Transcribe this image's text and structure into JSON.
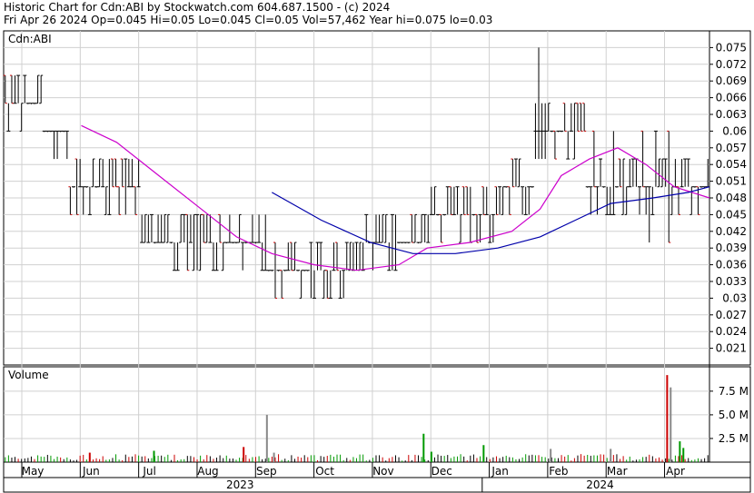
{
  "header": {
    "line1": "Historic Chart for Cdn:ABI by Stockwatch.com 604.687.1500 - (c) 2024",
    "line2": "Fri Apr 26 2024  Op=0.045  Hi=0.05  Lo=0.045  Cl=0.05  Vol=57,462  Year hi=0.075  lo=0.03"
  },
  "colors": {
    "background": "#ffffff",
    "grid": "#d0d0d0",
    "bar": "#000000",
    "bar_down": "#cc0000",
    "ma_short": "#cc00cc",
    "ma_long": "#0000aa",
    "vol_up": "#009900",
    "vol_down": "#cc0000",
    "vol_flat": "#000000"
  },
  "chart_data": [
    {
      "type": "ohlc",
      "panel": "price",
      "symbol_label": "Cdn:ABI",
      "ylim": [
        0.018,
        0.078
      ],
      "y_ticks": [
        "0.075",
        "0.072",
        "0.069",
        "0.066",
        "0.063",
        "0.06",
        "0.057",
        "0.054",
        "0.051",
        "0.048",
        "0.045",
        "0.042",
        "0.039",
        "0.036",
        "0.033",
        "0.03",
        "0.027",
        "0.024",
        "0.021"
      ],
      "x_month_labels": [
        "May",
        "Jun",
        "Jul",
        "Aug",
        "Sep",
        "Oct",
        "Nov",
        "Dec",
        "Jan",
        "Feb",
        "Mar",
        "Apr"
      ],
      "x_year_labels": [
        "2023",
        "2024"
      ],
      "grid": true,
      "segments": [
        {
          "days": 12,
          "levels": [
            0.065,
            0.07,
            0.06
          ],
          "pattern": "choppy"
        },
        {
          "days": 8,
          "levels": [
            0.06,
            0.06,
            0.055
          ],
          "pattern": "flat"
        },
        {
          "days": 22,
          "levels": [
            0.05,
            0.055,
            0.045
          ],
          "pattern": "choppy"
        },
        {
          "days": 14,
          "levels": [
            0.042,
            0.045,
            0.04
          ],
          "pattern": "choppy"
        },
        {
          "days": 25,
          "levels": [
            0.04,
            0.045,
            0.035
          ],
          "pattern": "choppy"
        },
        {
          "days": 20,
          "levels": [
            0.037,
            0.04,
            0.03
          ],
          "pattern": "choppy"
        },
        {
          "days": 10,
          "levels": [
            0.035,
            0.04,
            0.03
          ],
          "pattern": "choppy"
        },
        {
          "days": 20,
          "levels": [
            0.038,
            0.045,
            0.035
          ],
          "pattern": "choppy"
        },
        {
          "days": 22,
          "levels": [
            0.046,
            0.05,
            0.04
          ],
          "pattern": "choppy"
        },
        {
          "days": 10,
          "levels": [
            0.05,
            0.055,
            0.045
          ],
          "pattern": "choppy"
        },
        {
          "days": 4,
          "levels": [
            0.06,
            0.075,
            0.055
          ],
          "pattern": "spike"
        },
        {
          "days": 12,
          "levels": [
            0.06,
            0.065,
            0.055
          ],
          "pattern": "choppy"
        },
        {
          "days": 12,
          "levels": [
            0.052,
            0.06,
            0.045
          ],
          "pattern": "choppy"
        },
        {
          "days": 16,
          "levels": [
            0.048,
            0.06,
            0.04
          ],
          "pattern": "choppy"
        },
        {
          "days": 10,
          "levels": [
            0.048,
            0.05,
            0.045
          ],
          "pattern": "choppy"
        }
      ],
      "ma_short": {
        "name": "short moving average",
        "points": [
          [
            0.11,
            0.061
          ],
          [
            0.16,
            0.058
          ],
          [
            0.22,
            0.052
          ],
          [
            0.28,
            0.046
          ],
          [
            0.33,
            0.041
          ],
          [
            0.38,
            0.038
          ],
          [
            0.44,
            0.036
          ],
          [
            0.5,
            0.035
          ],
          [
            0.56,
            0.036
          ],
          [
            0.6,
            0.039
          ],
          [
            0.66,
            0.04
          ],
          [
            0.72,
            0.042
          ],
          [
            0.76,
            0.046
          ],
          [
            0.79,
            0.052
          ],
          [
            0.83,
            0.055
          ],
          [
            0.87,
            0.057
          ],
          [
            0.91,
            0.054
          ],
          [
            0.95,
            0.05
          ],
          [
            1.0,
            0.048
          ]
        ]
      },
      "ma_long": {
        "name": "long moving average",
        "points": [
          [
            0.38,
            0.049
          ],
          [
            0.45,
            0.044
          ],
          [
            0.52,
            0.04
          ],
          [
            0.58,
            0.038
          ],
          [
            0.64,
            0.038
          ],
          [
            0.7,
            0.039
          ],
          [
            0.76,
            0.041
          ],
          [
            0.81,
            0.044
          ],
          [
            0.86,
            0.047
          ],
          [
            0.92,
            0.048
          ],
          [
            0.97,
            0.049
          ],
          [
            1.0,
            0.05
          ]
        ]
      }
    },
    {
      "type": "bar",
      "panel": "volume",
      "title": "Volume",
      "ylim": [
        0,
        9.5
      ],
      "unit": "M",
      "y_ticks": [
        "7.5 M",
        "5.0 M",
        "2.5 M"
      ],
      "grid": true,
      "spikes": [
        {
          "pos": 0.122,
          "value": 1.0,
          "dir": "down"
        },
        {
          "pos": 0.213,
          "value": 1.2,
          "dir": "up"
        },
        {
          "pos": 0.34,
          "value": 1.6,
          "dir": "down"
        },
        {
          "pos": 0.373,
          "value": 5.0,
          "dir": "flat"
        },
        {
          "pos": 0.383,
          "value": 1.0,
          "dir": "flat"
        },
        {
          "pos": 0.595,
          "value": 3.0,
          "dir": "up"
        },
        {
          "pos": 0.606,
          "value": 1.1,
          "dir": "up"
        },
        {
          "pos": 0.68,
          "value": 1.8,
          "dir": "up"
        },
        {
          "pos": 0.775,
          "value": 1.4,
          "dir": "flat"
        },
        {
          "pos": 0.86,
          "value": 1.4,
          "dir": "flat"
        },
        {
          "pos": 0.94,
          "value": 9.2,
          "dir": "down"
        },
        {
          "pos": 0.945,
          "value": 7.9,
          "dir": "flat"
        },
        {
          "pos": 0.958,
          "value": 2.2,
          "dir": "up"
        },
        {
          "pos": 0.963,
          "value": 1.5,
          "dir": "up"
        }
      ]
    }
  ]
}
